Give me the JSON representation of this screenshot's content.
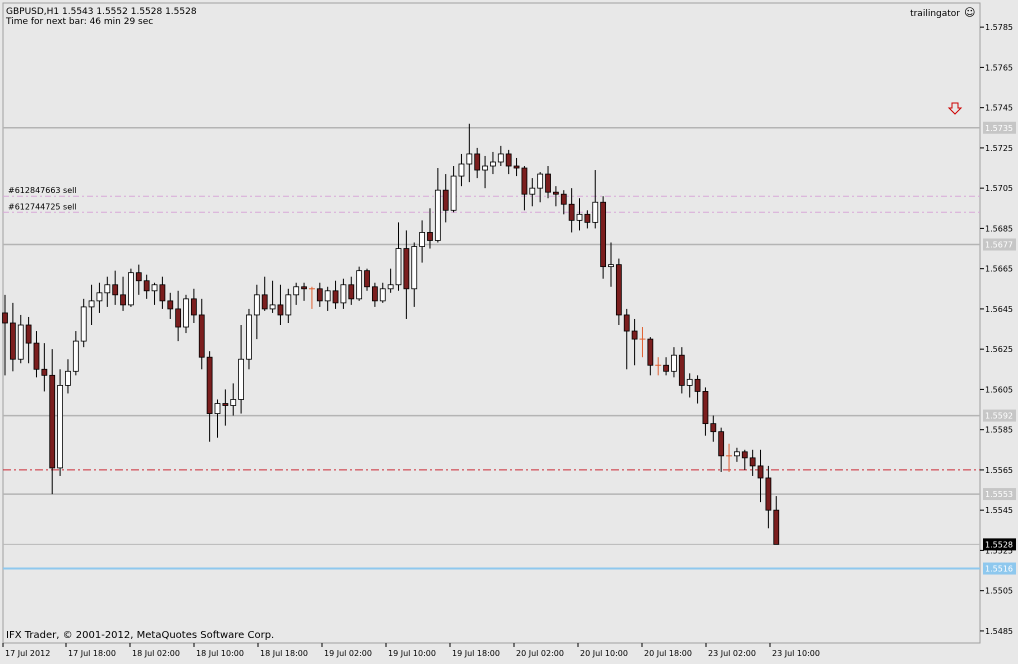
{
  "header": {
    "symbol_line": "GBPUSD,H1  1.5543 1.5552 1.5528 1.5528",
    "timer_line": "Time for next bar: 46 min 29 sec"
  },
  "expert": {
    "name": "trailingator",
    "face_glyph": "☺"
  },
  "footer": {
    "copyright": "IFX Trader, © 2001-2012, MetaQuotes Software Corp."
  },
  "colors": {
    "background": "#e8e8e8",
    "bear_body": "#7b1e1e",
    "bull_body": "#ffffff",
    "wick": "#000000",
    "doji": "#e06030",
    "level_line": "#b4b4b4",
    "order_line": "#d8a8d8",
    "stop_line": "#cc2a36",
    "bid_line": "#b8b8b8",
    "alert_line": "#8ec8ee",
    "arrow": "#cc0000"
  },
  "chart_data": {
    "type": "candlestick",
    "symbol": "GBPUSD",
    "timeframe": "H1",
    "ohlc_now": {
      "open": 1.5543,
      "high": 1.5552,
      "low": 1.5528,
      "close": 1.5528
    },
    "y_axis": {
      "ticks": [
        "1.5785",
        "1.5765",
        "1.5745",
        "1.5725",
        "1.5705",
        "1.5685",
        "1.5665",
        "1.5645",
        "1.5625",
        "1.5605",
        "1.5585",
        "1.5565",
        "1.5545",
        "1.5525",
        "1.5505",
        "1.5485"
      ],
      "range": [
        1.5479,
        1.5797
      ]
    },
    "x_axis": {
      "ticks": [
        "17 Jul 2012",
        "17 Jul 18:00",
        "18 Jul 02:00",
        "18 Jul 10:00",
        "18 Jul 18:00",
        "19 Jul 02:00",
        "19 Jul 10:00",
        "19 Jul 18:00",
        "20 Jul 02:00",
        "20 Jul 10:00",
        "20 Jul 18:00",
        "23 Jul 02:00",
        "23 Jul 10:00"
      ]
    },
    "price_levels": [
      {
        "price": 1.5735,
        "label": "1.5735",
        "kind": "level"
      },
      {
        "price": 1.5677,
        "label": "1.5677",
        "kind": "level"
      },
      {
        "price": 1.5592,
        "label": "1.5592",
        "kind": "level"
      },
      {
        "price": 1.5553,
        "label": "1.5553",
        "kind": "level"
      },
      {
        "price": 1.5516,
        "label": "1.5516",
        "kind": "alert"
      }
    ],
    "order_lines": [
      {
        "price": 1.5701,
        "label": "#612847663 sell"
      },
      {
        "price": 1.5693,
        "label": "#612744725 sell"
      }
    ],
    "stop_line": {
      "price": 1.5565
    },
    "bid": {
      "price": 1.5528,
      "label": "1.5528"
    },
    "candles": [
      {
        "o": 1.5643,
        "h": 1.5652,
        "l": 1.5612,
        "c": 1.5638
      },
      {
        "o": 1.5638,
        "h": 1.5648,
        "l": 1.5614,
        "c": 1.562
      },
      {
        "o": 1.562,
        "h": 1.5642,
        "l": 1.5618,
        "c": 1.5637
      },
      {
        "o": 1.5637,
        "h": 1.5641,
        "l": 1.5618,
        "c": 1.5628
      },
      {
        "o": 1.5628,
        "h": 1.5634,
        "l": 1.5611,
        "c": 1.5615
      },
      {
        "o": 1.5615,
        "h": 1.5628,
        "l": 1.5604,
        "c": 1.5612
      },
      {
        "o": 1.5612,
        "h": 1.5625,
        "l": 1.5553,
        "c": 1.5566
      },
      {
        "o": 1.5566,
        "h": 1.5615,
        "l": 1.5562,
        "c": 1.5607
      },
      {
        "o": 1.5607,
        "h": 1.562,
        "l": 1.5603,
        "c": 1.5614
      },
      {
        "o": 1.5614,
        "h": 1.5634,
        "l": 1.5612,
        "c": 1.5629
      },
      {
        "o": 1.5629,
        "h": 1.565,
        "l": 1.5626,
        "c": 1.5646
      },
      {
        "o": 1.5646,
        "h": 1.5657,
        "l": 1.5637,
        "c": 1.5649
      },
      {
        "o": 1.5649,
        "h": 1.5658,
        "l": 1.5643,
        "c": 1.5653
      },
      {
        "o": 1.5653,
        "h": 1.5661,
        "l": 1.5646,
        "c": 1.5657
      },
      {
        "o": 1.5657,
        "h": 1.5664,
        "l": 1.5647,
        "c": 1.5652
      },
      {
        "o": 1.5652,
        "h": 1.5661,
        "l": 1.5644,
        "c": 1.5647
      },
      {
        "o": 1.5647,
        "h": 1.5665,
        "l": 1.5646,
        "c": 1.5663
      },
      {
        "o": 1.5663,
        "h": 1.5667,
        "l": 1.5652,
        "c": 1.5659
      },
      {
        "o": 1.5659,
        "h": 1.5662,
        "l": 1.565,
        "c": 1.5654
      },
      {
        "o": 1.5654,
        "h": 1.5658,
        "l": 1.5647,
        "c": 1.5657
      },
      {
        "o": 1.5657,
        "h": 1.5661,
        "l": 1.5645,
        "c": 1.5649
      },
      {
        "o": 1.5649,
        "h": 1.5653,
        "l": 1.564,
        "c": 1.5645
      },
      {
        "o": 1.5645,
        "h": 1.5654,
        "l": 1.5629,
        "c": 1.5636
      },
      {
        "o": 1.5636,
        "h": 1.5652,
        "l": 1.5633,
        "c": 1.565
      },
      {
        "o": 1.565,
        "h": 1.5655,
        "l": 1.5638,
        "c": 1.5642
      },
      {
        "o": 1.5642,
        "h": 1.565,
        "l": 1.5615,
        "c": 1.5621
      },
      {
        "o": 1.5621,
        "h": 1.5624,
        "l": 1.5579,
        "c": 1.5593
      },
      {
        "o": 1.5593,
        "h": 1.56,
        "l": 1.5581,
        "c": 1.5598
      },
      {
        "o": 1.5598,
        "h": 1.5605,
        "l": 1.5587,
        "c": 1.5597
      },
      {
        "o": 1.5597,
        "h": 1.5608,
        "l": 1.5592,
        "c": 1.56
      },
      {
        "o": 1.56,
        "h": 1.5637,
        "l": 1.5593,
        "c": 1.562
      },
      {
        "o": 1.562,
        "h": 1.5645,
        "l": 1.5615,
        "c": 1.5642
      },
      {
        "o": 1.5642,
        "h": 1.5657,
        "l": 1.563,
        "c": 1.5652
      },
      {
        "o": 1.5652,
        "h": 1.5661,
        "l": 1.5644,
        "c": 1.5645
      },
      {
        "o": 1.5645,
        "h": 1.5659,
        "l": 1.5643,
        "c": 1.5647
      },
      {
        "o": 1.5647,
        "h": 1.5657,
        "l": 1.5637,
        "c": 1.5642
      },
      {
        "o": 1.5642,
        "h": 1.5655,
        "l": 1.5638,
        "c": 1.5652
      },
      {
        "o": 1.5652,
        "h": 1.5658,
        "l": 1.5647,
        "c": 1.5656
      },
      {
        "o": 1.5656,
        "h": 1.5658,
        "l": 1.5649,
        "c": 1.5655
      },
      {
        "o": 1.5655,
        "h": 1.5656,
        "l": 1.5645,
        "c": 1.5655
      },
      {
        "o": 1.5655,
        "h": 1.5658,
        "l": 1.5646,
        "c": 1.5649
      },
      {
        "o": 1.5649,
        "h": 1.5656,
        "l": 1.5644,
        "c": 1.5654
      },
      {
        "o": 1.5654,
        "h": 1.5659,
        "l": 1.5645,
        "c": 1.5648
      },
      {
        "o": 1.5648,
        "h": 1.566,
        "l": 1.5645,
        "c": 1.5657
      },
      {
        "o": 1.5657,
        "h": 1.5661,
        "l": 1.5647,
        "c": 1.565
      },
      {
        "o": 1.565,
        "h": 1.5666,
        "l": 1.5649,
        "c": 1.5664
      },
      {
        "o": 1.5664,
        "h": 1.5665,
        "l": 1.5654,
        "c": 1.5656
      },
      {
        "o": 1.5656,
        "h": 1.5658,
        "l": 1.5646,
        "c": 1.5649
      },
      {
        "o": 1.5649,
        "h": 1.5658,
        "l": 1.5648,
        "c": 1.5655
      },
      {
        "o": 1.5655,
        "h": 1.5665,
        "l": 1.5653,
        "c": 1.5657
      },
      {
        "o": 1.5657,
        "h": 1.5688,
        "l": 1.5654,
        "c": 1.5675
      },
      {
        "o": 1.5675,
        "h": 1.5684,
        "l": 1.564,
        "c": 1.5655
      },
      {
        "o": 1.5655,
        "h": 1.5678,
        "l": 1.5646,
        "c": 1.5676
      },
      {
        "o": 1.5676,
        "h": 1.5689,
        "l": 1.5668,
        "c": 1.5683
      },
      {
        "o": 1.5683,
        "h": 1.5695,
        "l": 1.5675,
        "c": 1.5679
      },
      {
        "o": 1.5679,
        "h": 1.5715,
        "l": 1.5678,
        "c": 1.5704
      },
      {
        "o": 1.5704,
        "h": 1.5712,
        "l": 1.5688,
        "c": 1.5694
      },
      {
        "o": 1.5694,
        "h": 1.5716,
        "l": 1.5693,
        "c": 1.5711
      },
      {
        "o": 1.5711,
        "h": 1.5722,
        "l": 1.5706,
        "c": 1.5717
      },
      {
        "o": 1.5717,
        "h": 1.5737,
        "l": 1.5708,
        "c": 1.5722
      },
      {
        "o": 1.5722,
        "h": 1.5725,
        "l": 1.571,
        "c": 1.5714
      },
      {
        "o": 1.5714,
        "h": 1.5721,
        "l": 1.5705,
        "c": 1.5716
      },
      {
        "o": 1.5716,
        "h": 1.5723,
        "l": 1.5712,
        "c": 1.5718
      },
      {
        "o": 1.5718,
        "h": 1.5726,
        "l": 1.5716,
        "c": 1.5722
      },
      {
        "o": 1.5722,
        "h": 1.5724,
        "l": 1.5712,
        "c": 1.5716
      },
      {
        "o": 1.5716,
        "h": 1.572,
        "l": 1.5711,
        "c": 1.5715
      },
      {
        "o": 1.5715,
        "h": 1.5716,
        "l": 1.5694,
        "c": 1.5702
      },
      {
        "o": 1.5702,
        "h": 1.571,
        "l": 1.5696,
        "c": 1.5705
      },
      {
        "o": 1.5705,
        "h": 1.5713,
        "l": 1.5698,
        "c": 1.5712
      },
      {
        "o": 1.5712,
        "h": 1.5716,
        "l": 1.57,
        "c": 1.5703
      },
      {
        "o": 1.5703,
        "h": 1.5706,
        "l": 1.5696,
        "c": 1.5702
      },
      {
        "o": 1.5702,
        "h": 1.5704,
        "l": 1.5692,
        "c": 1.5697
      },
      {
        "o": 1.5697,
        "h": 1.5705,
        "l": 1.5683,
        "c": 1.5689
      },
      {
        "o": 1.5689,
        "h": 1.57,
        "l": 1.5684,
        "c": 1.5692
      },
      {
        "o": 1.5692,
        "h": 1.5694,
        "l": 1.5685,
        "c": 1.5688
      },
      {
        "o": 1.5688,
        "h": 1.5714,
        "l": 1.5685,
        "c": 1.5698
      },
      {
        "o": 1.5698,
        "h": 1.5701,
        "l": 1.566,
        "c": 1.5666
      },
      {
        "o": 1.5666,
        "h": 1.5678,
        "l": 1.5656,
        "c": 1.5667
      },
      {
        "o": 1.5667,
        "h": 1.567,
        "l": 1.5637,
        "c": 1.5642
      },
      {
        "o": 1.5642,
        "h": 1.5645,
        "l": 1.5615,
        "c": 1.5634
      },
      {
        "o": 1.5634,
        "h": 1.564,
        "l": 1.5617,
        "c": 1.563
      },
      {
        "o": 1.563,
        "h": 1.5636,
        "l": 1.5621,
        "c": 1.563
      },
      {
        "o": 1.563,
        "h": 1.5631,
        "l": 1.5612,
        "c": 1.5617
      },
      {
        "o": 1.5617,
        "h": 1.5621,
        "l": 1.5612,
        "c": 1.5617
      },
      {
        "o": 1.5617,
        "h": 1.5621,
        "l": 1.5612,
        "c": 1.5614
      },
      {
        "o": 1.5614,
        "h": 1.5626,
        "l": 1.5611,
        "c": 1.5622
      },
      {
        "o": 1.5622,
        "h": 1.5626,
        "l": 1.5603,
        "c": 1.5607
      },
      {
        "o": 1.5607,
        "h": 1.5613,
        "l": 1.5601,
        "c": 1.561
      },
      {
        "o": 1.561,
        "h": 1.5612,
        "l": 1.5598,
        "c": 1.5604
      },
      {
        "o": 1.5604,
        "h": 1.5606,
        "l": 1.5582,
        "c": 1.5588
      },
      {
        "o": 1.5588,
        "h": 1.5592,
        "l": 1.5579,
        "c": 1.5584
      },
      {
        "o": 1.5584,
        "h": 1.5586,
        "l": 1.5564,
        "c": 1.5572
      },
      {
        "o": 1.5572,
        "h": 1.5578,
        "l": 1.5564,
        "c": 1.5572
      },
      {
        "o": 1.5572,
        "h": 1.5576,
        "l": 1.5569,
        "c": 1.5574
      },
      {
        "o": 1.5574,
        "h": 1.5575,
        "l": 1.5565,
        "c": 1.5571
      },
      {
        "o": 1.5571,
        "h": 1.5575,
        "l": 1.5562,
        "c": 1.5567
      },
      {
        "o": 1.5567,
        "h": 1.5575,
        "l": 1.5549,
        "c": 1.5561
      },
      {
        "o": 1.5561,
        "h": 1.5567,
        "l": 1.5536,
        "c": 1.5545
      },
      {
        "o": 1.5545,
        "h": 1.5552,
        "l": 1.5528,
        "c": 1.5528
      }
    ]
  }
}
